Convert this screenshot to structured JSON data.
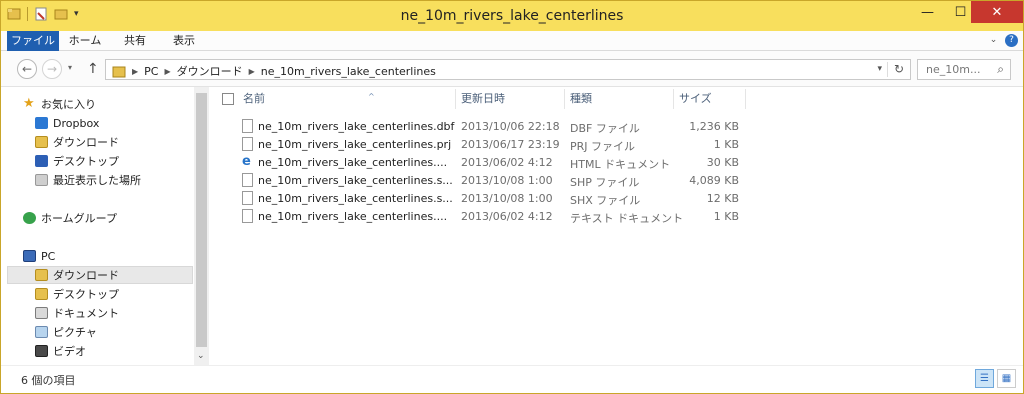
{
  "window": {
    "title": "ne_10m_rivers_lake_centerlines",
    "controls": {
      "minimize": "—",
      "maximize": "☐",
      "close": "✕"
    },
    "quick_access_dropdown": "▾"
  },
  "ribbon": {
    "tabs": [
      "ファイル",
      "ホーム",
      "共有",
      "表示"
    ],
    "expand_icon": "⌄",
    "help_icon": "?"
  },
  "nav": {
    "back": "←",
    "forward": "→",
    "history": "▾",
    "up": "↑",
    "breadcrumb": [
      "PC",
      "ダウンロード",
      "ne_10m_rivers_lake_centerlines"
    ],
    "address_dropdown": "▾",
    "refresh": "↻",
    "search_placeholder": "ne_10m...",
    "search_icon": "⌕"
  },
  "sidebar": {
    "items": [
      {
        "label": "お気に入り",
        "icon": "star-icon"
      },
      {
        "label": "Dropbox",
        "icon": "dropbox-icon"
      },
      {
        "label": "ダウンロード",
        "icon": "folder-icon"
      },
      {
        "label": "デスクトップ",
        "icon": "desktop-icon"
      },
      {
        "label": "最近表示した場所",
        "icon": "recent-places-icon"
      },
      {
        "label": "ホームグループ",
        "icon": "homegroup-icon"
      },
      {
        "label": "PC",
        "icon": "pc-icon"
      },
      {
        "label": "ダウンロード",
        "icon": "downloads-folder-icon"
      },
      {
        "label": "デスクトップ",
        "icon": "desktop-folder-icon"
      },
      {
        "label": "ドキュメント",
        "icon": "documents-folder-icon"
      },
      {
        "label": "ピクチャ",
        "icon": "pictures-folder-icon"
      },
      {
        "label": "ビデオ",
        "icon": "videos-folder-icon"
      }
    ],
    "scroll_down": "⌄"
  },
  "list": {
    "columns": {
      "name": "名前",
      "date": "更新日時",
      "type": "種類",
      "size": "サイズ"
    },
    "sort_indicator": "^",
    "files": [
      {
        "name": "ne_10m_rivers_lake_centerlines.dbf",
        "date": "2013/10/06 22:18",
        "type": "DBF ファイル",
        "size": "1,236 KB"
      },
      {
        "name": "ne_10m_rivers_lake_centerlines.prj",
        "date": "2013/06/17 23:19",
        "type": "PRJ ファイル",
        "size": "1 KB"
      },
      {
        "name": "ne_10m_rivers_lake_centerlines....",
        "date": "2013/06/02 4:12",
        "type": "HTML ドキュメント",
        "size": "30 KB"
      },
      {
        "name": "ne_10m_rivers_lake_centerlines.s...",
        "date": "2013/10/08 1:00",
        "type": "SHP ファイル",
        "size": "4,089 KB"
      },
      {
        "name": "ne_10m_rivers_lake_centerlines.s...",
        "date": "2013/10/08 1:00",
        "type": "SHX ファイル",
        "size": "12 KB"
      },
      {
        "name": "ne_10m_rivers_lake_centerlines....",
        "date": "2013/06/02 4:12",
        "type": "テキスト ドキュメント",
        "size": "1 KB"
      }
    ]
  },
  "status": {
    "item_count": "6 個の項目",
    "details_view": "☰",
    "tiles_view": "▦"
  }
}
